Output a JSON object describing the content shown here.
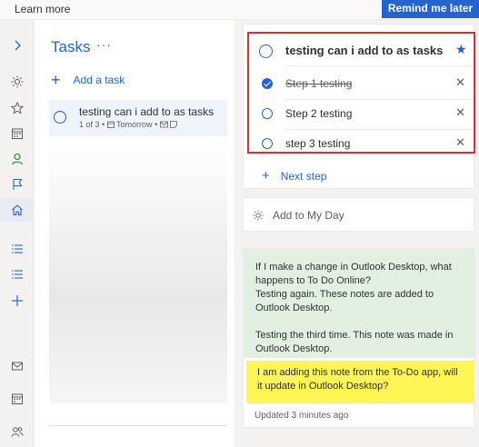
{
  "banner": {
    "learn_more": "Learn more",
    "remind_later": "Remind me later"
  },
  "rail": {
    "icons": [
      "chevron-right-icon",
      "sun-icon",
      "star-icon",
      "calendar-icon",
      "person-icon",
      "flag-icon",
      "home-icon",
      "list-icon",
      "list-icon",
      "plus-icon",
      "mail-icon",
      "calendar-icon",
      "people-icon"
    ]
  },
  "list": {
    "title": "Tasks",
    "more": "···",
    "add_task": "Add a task",
    "tasks": [
      {
        "title": "testing can i add to as tasks",
        "steps_count": "1 of 3",
        "due": "Tomorrow"
      }
    ]
  },
  "detail": {
    "task_title": "testing can i add to as tasks",
    "important": true,
    "steps": [
      {
        "label": "Step 1 testing",
        "done": true
      },
      {
        "label": "Step 2 testing",
        "done": false
      },
      {
        "label": "step 3 testing",
        "done": false
      }
    ],
    "next_step": "Next step",
    "add_to_my_day": "Add to My Day",
    "note_lines": [
      "If I make a change in Outlook Desktop, what happens to To Do Online?",
      "Testing again. These notes are added to Outlook Desktop.",
      "Testing the third time. This note was made in Outlook Desktop."
    ],
    "note_yellow": "I am adding this note from the To-Do app, will it update in Outlook Desktop?",
    "updated": "Updated 3 minutes ago"
  },
  "colors": {
    "accent": "#2564cf",
    "highlight_border": "#d13438",
    "note_green": "#e1f0e1",
    "note_yellow": "#fdf654"
  }
}
